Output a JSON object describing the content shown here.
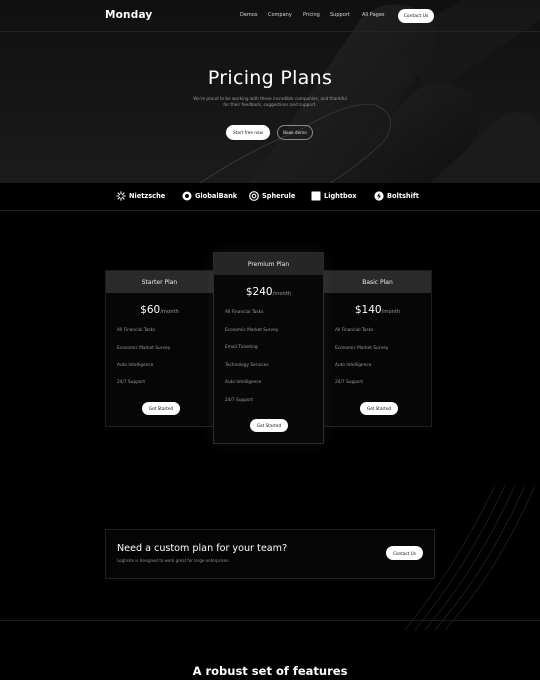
{
  "nav": {
    "logo": "Monday",
    "links": [
      "Demos",
      "Company",
      "Pricing",
      "Support",
      "All Pages"
    ],
    "cta": "Contact Us"
  },
  "hero": {
    "title": "Pricing Plans",
    "subtitle": "We're proud to be working with these incredible companies, and thankful for their feedback, suggestions and support.",
    "primary_button": "Start free now",
    "secondary_button": "Book demo"
  },
  "brands": [
    {
      "name": "Nietzsche",
      "icon": "sunburst-icon"
    },
    {
      "name": "GlobalBank",
      "icon": "globe-icon"
    },
    {
      "name": "Spherule",
      "icon": "sphere-icon"
    },
    {
      "name": "Lightbox",
      "icon": "box-icon"
    },
    {
      "name": "Boltshift",
      "icon": "bolt-icon"
    }
  ],
  "plans": {
    "starter": {
      "name": "Starter Plan",
      "price": "$60",
      "period": "/month",
      "features": [
        "All Financial Tasks",
        "Economic Market Survey",
        "Auto Intelligence",
        "24/7 Support"
      ],
      "button": "Get Started"
    },
    "premium": {
      "name": "Premium Plan",
      "price": "$240",
      "period": "/month",
      "features": [
        "All Financial Tasks",
        "Economic Market Survey",
        "Email Ticketing",
        "Technology Services",
        "Auto Intelligence",
        "24/7 Support"
      ],
      "button": "Get Started"
    },
    "basic": {
      "name": "Basic Plan",
      "price": "$140",
      "period": "/month",
      "features": [
        "All Financial Tasks",
        "Economic Market Survey",
        "Auto Intelligence",
        "24/7 Support"
      ],
      "button": "Get Started"
    }
  },
  "custom": {
    "title": "Need a custom plan for your team?",
    "subtitle": "Logtisite is designed to work great for large enterprises.",
    "button": "Contact Us"
  },
  "features": {
    "title": "A robust set of features"
  },
  "colors": {
    "background": "#000000",
    "accent": "#ffffff",
    "card_header": "#2a2a2a",
    "muted_text": "#9c9c9c"
  }
}
